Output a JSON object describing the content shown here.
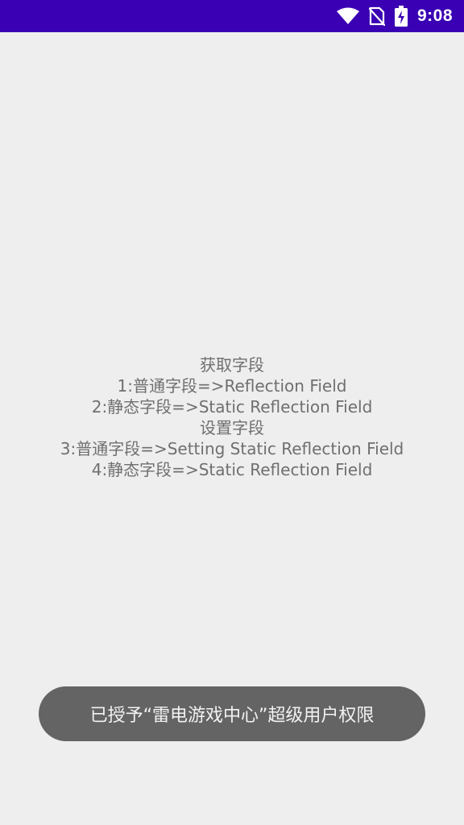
{
  "status_bar": {
    "time": "9:08",
    "background_color": "#3a00b3",
    "icons": [
      "wifi-icon",
      "no-sim-icon",
      "battery-charging-icon"
    ]
  },
  "content": {
    "lines": [
      "获取字段",
      "1:普通字段=>Reflection Field",
      "2:静态字段=>Static Reflection Field",
      "设置字段",
      "3:普通字段=>Setting Static Reflection Field",
      "4:静态字段=>Static Reflection Field"
    ]
  },
  "toast": {
    "message": "已授予“雷电游戏中心”超级用户权限"
  }
}
